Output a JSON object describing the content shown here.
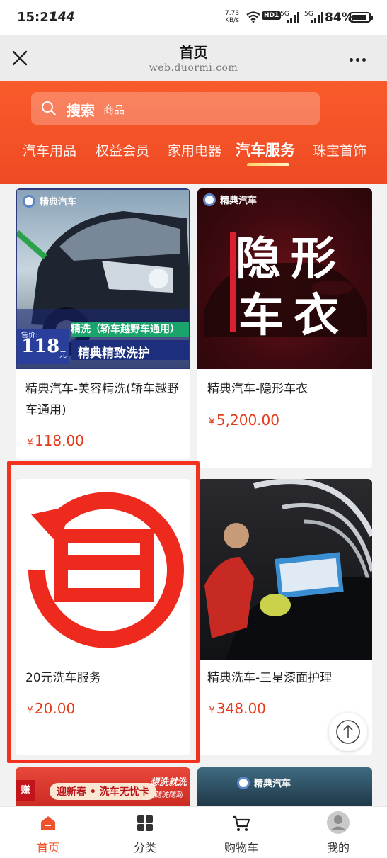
{
  "status_bar": {
    "time": "15:21",
    "refresh_rate": "144",
    "net_speed_value": "7.73",
    "net_speed_unit": "KB/s",
    "hd_badge": "HD1",
    "network_1": "5G",
    "network_2": "5G",
    "battery": "84%"
  },
  "browser": {
    "title": "首页",
    "url": "web.duormi.com"
  },
  "search": {
    "keyword": "搜索",
    "placeholder": "商品"
  },
  "tabs": [
    "汽车用品",
    "权益会员",
    "家用电器",
    "汽车服务",
    "珠宝首饰"
  ],
  "active_tab": "汽车服务",
  "products": [
    {
      "name": "精典汽车-美容精洗(轿车越野车通用)",
      "currency": "¥",
      "price": "118.00",
      "image": {
        "brand": "精典汽车",
        "banner": "精洗（轿车越野车通用）",
        "price_tag_label": "售价:",
        "price_tag_value": "118",
        "price_tag_unit": "元",
        "caption": "精典精致洗护"
      }
    },
    {
      "name": "精典汽车-隐形车衣",
      "currency": "¥",
      "price": "5,200.00",
      "image": {
        "brand": "精典汽车",
        "line1": "隐形",
        "line2": "车衣"
      }
    },
    {
      "name": "20元洗车服务",
      "currency": "¥",
      "price": "20.00",
      "image": {}
    },
    {
      "name": "精典洗车-三星漆面护理",
      "currency": "¥",
      "price": "348.00",
      "image": {}
    },
    {
      "image": {
        "ribbon": "迎新春 • 洗车无忧卡",
        "corner": "赚",
        "badge_line1": "想洗就洗",
        "badge_line2": "随洗随到"
      }
    },
    {
      "image": {
        "brand": "精典汽车"
      }
    }
  ],
  "bottom_nav": [
    {
      "label": "首页",
      "icon": "home-icon",
      "active": true
    },
    {
      "label": "分类",
      "icon": "category-icon",
      "active": false
    },
    {
      "label": "购物车",
      "icon": "cart-icon",
      "active": false
    },
    {
      "label": "我的",
      "icon": "profile-icon",
      "active": false
    }
  ],
  "colors": {
    "accent": "#f0522b",
    "price": "#e43a1a",
    "highlight_frame": "#f2311e"
  }
}
